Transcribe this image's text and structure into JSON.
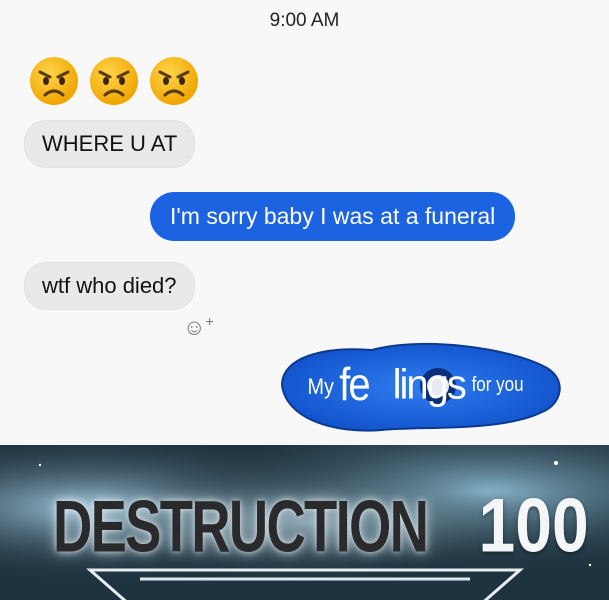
{
  "chat": {
    "timestamp": "9:00 AM",
    "emojis": [
      "angry-face-icon",
      "angry-face-icon",
      "angry-face-icon"
    ],
    "messages": [
      {
        "side": "incoming",
        "text": "WHERE U AT"
      },
      {
        "side": "outgoing",
        "text": "I'm sorry baby I was at a funeral"
      },
      {
        "side": "incoming",
        "text": "wtf who died?"
      },
      {
        "side": "outgoing",
        "text_parts": [
          "My",
          "fe",
          "lings",
          "for you"
        ]
      }
    ],
    "reaction_icon": "add-reaction-icon"
  },
  "banner": {
    "skill": "DESTRUCTION",
    "level": "100"
  },
  "colors": {
    "incoming_bubble": "#e9e9eb",
    "outgoing_bubble": "#1b63e0",
    "banner_bg": "#1c2d38"
  }
}
